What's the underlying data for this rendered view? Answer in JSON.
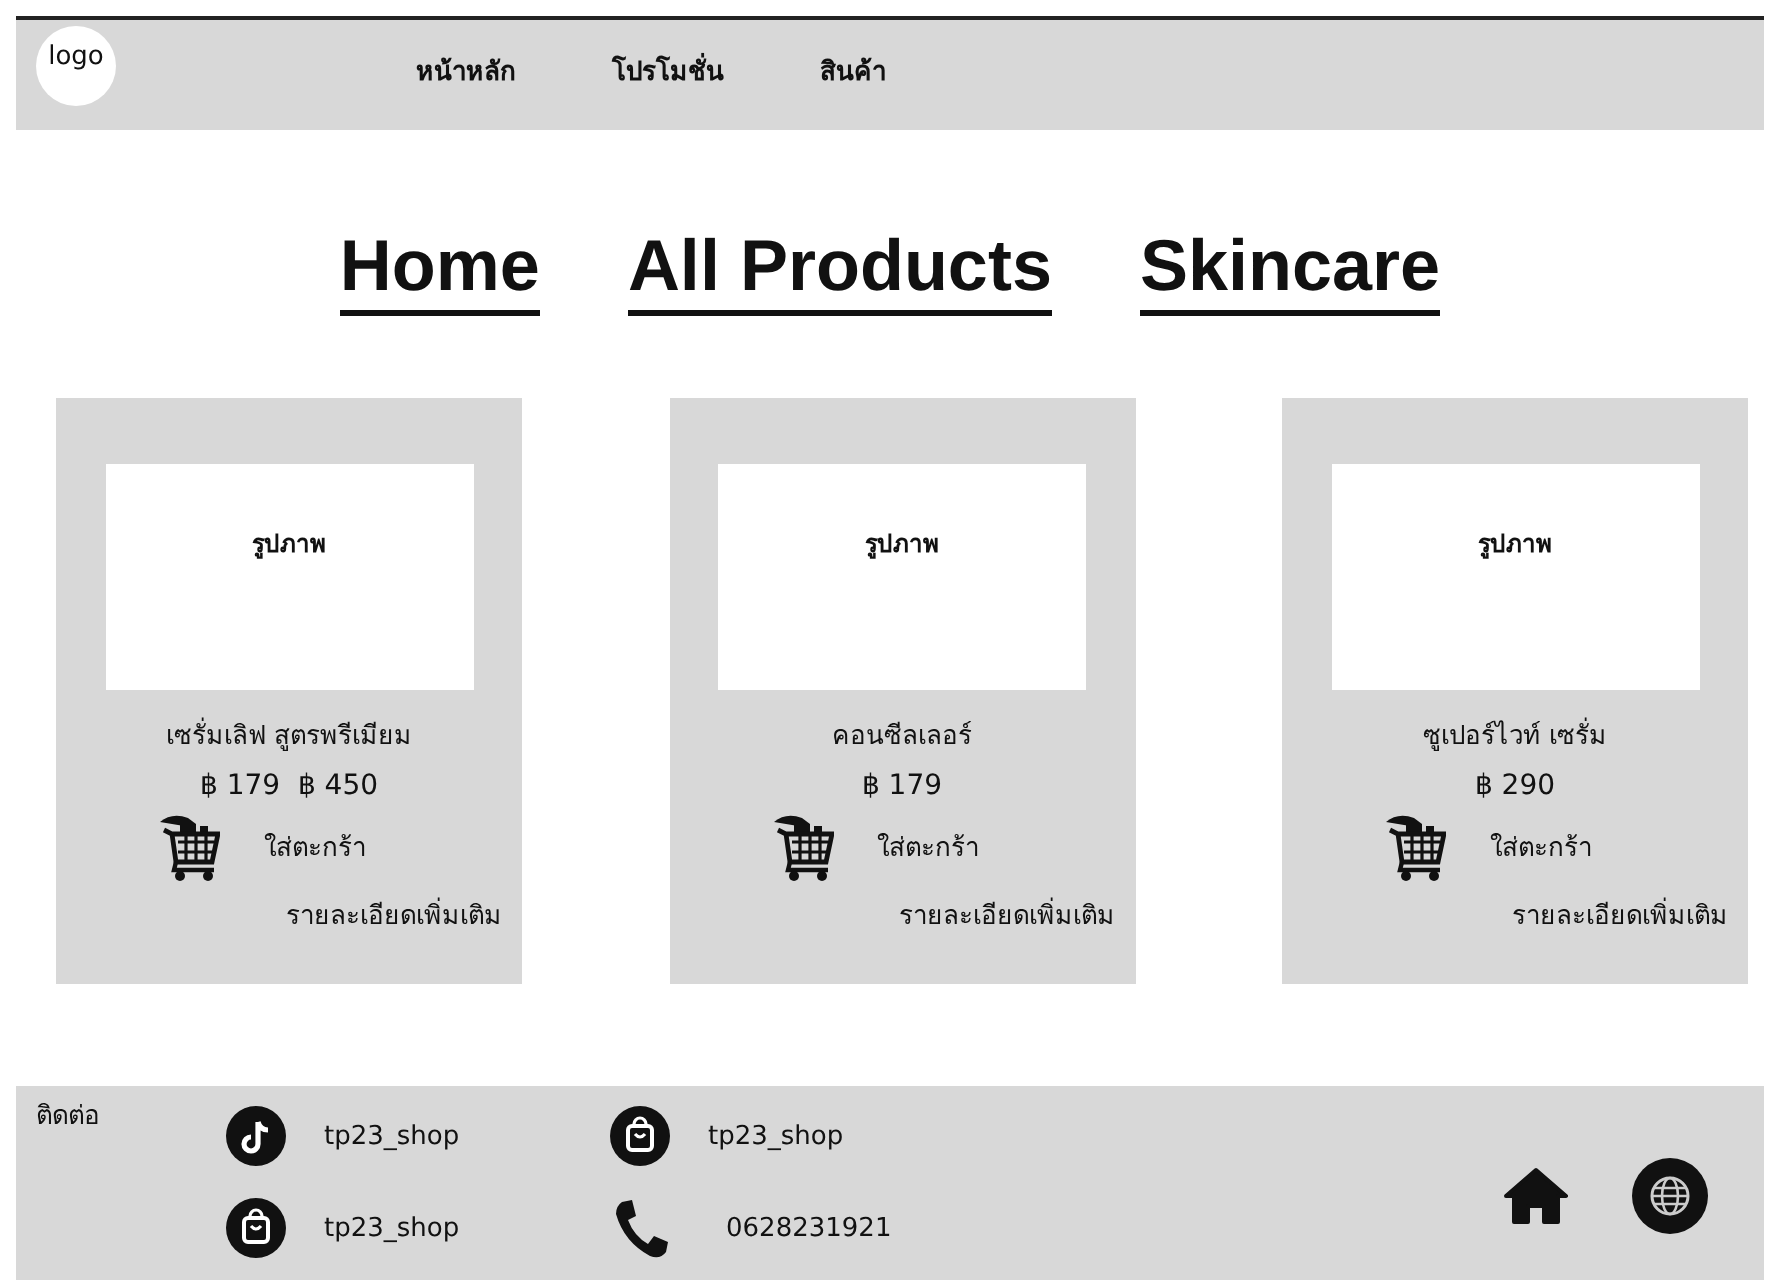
{
  "header": {
    "logo": "logo",
    "nav": [
      {
        "label": "หน้าหลัก"
      },
      {
        "label": "โปรโมชั่น"
      },
      {
        "label": "สินค้า"
      }
    ]
  },
  "headings": [
    {
      "label": "Home"
    },
    {
      "label": "All Products"
    },
    {
      "label": "Skincare"
    }
  ],
  "products": [
    {
      "image_label": "รูปภาพ",
      "name": "เซรั่มเลิฟ สูตรพรีเมียม",
      "price": "฿ 179  ฿ 450",
      "cart_label": "ใส่ตะกร้า",
      "details_label": "รายละเอียดเพิ่มเติม"
    },
    {
      "image_label": "รูปภาพ",
      "name": "คอนซีลเลอร์",
      "price": "฿ 179",
      "cart_label": "ใส่ตะกร้า",
      "details_label": "รายละเอียดเพิ่มเติม"
    },
    {
      "image_label": "รูปภาพ",
      "name": "ซูเปอร์ไวท์ เซรั่ม",
      "price": "฿ 290",
      "cart_label": "ใส่ตะกร้า",
      "details_label": "รายละเอียดเพิ่มเติม"
    }
  ],
  "footer": {
    "contact_label": "ติดต่อ",
    "contacts": [
      {
        "kind": "tiktok",
        "text": "tp23_shop"
      },
      {
        "kind": "shop",
        "text": "tp23_shop"
      },
      {
        "kind": "shop",
        "text": "tp23_shop"
      },
      {
        "kind": "phone",
        "text": "0628231921"
      }
    ]
  }
}
